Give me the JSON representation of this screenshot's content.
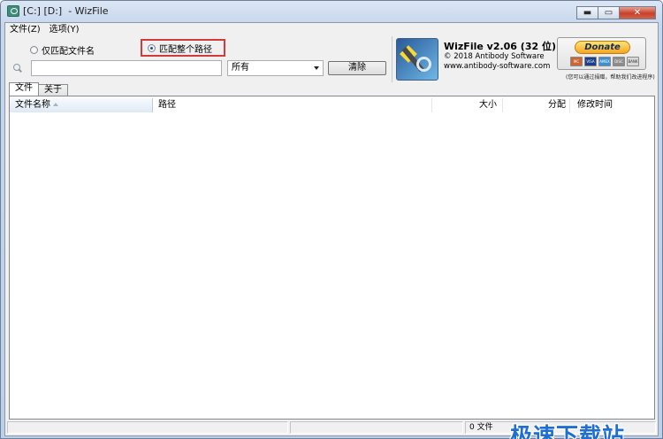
{
  "window": {
    "title": "[C:] [D:]  - WizFile",
    "controls": {
      "minimize": "▬",
      "maximize": "▭",
      "close": "✕"
    }
  },
  "menu": [
    "文件(Z)",
    "选项(Y)"
  ],
  "search": {
    "radio_filename_only": "仅匹配文件名",
    "radio_full_path": "匹配整个路径",
    "selected": "full_path",
    "input_value": "",
    "type_value": "所有",
    "clear_label": "清除"
  },
  "brand": {
    "title": "WizFile v2.06 (32 位)",
    "copyright": "© 2018 Antibody Software",
    "url": "www.antibody-software.com",
    "donate_label": "Donate",
    "cards": [
      "MC",
      "VISA",
      "AMEX",
      "DISC",
      "BANK"
    ],
    "donate_note": "(您可以通过捐赠，帮助我们改进程序)"
  },
  "tabs": [
    "文件",
    "关于"
  ],
  "active_tab": 0,
  "columns": {
    "name": "文件名称",
    "path": "路径",
    "size": "大小",
    "alloc": "分配",
    "modified": "修改时间"
  },
  "status": {
    "count": "0 文件"
  },
  "watermark": "极速下载站",
  "colors": {
    "accent_red": "#d33a3a",
    "watermark_blue": "#1f6fd0"
  }
}
